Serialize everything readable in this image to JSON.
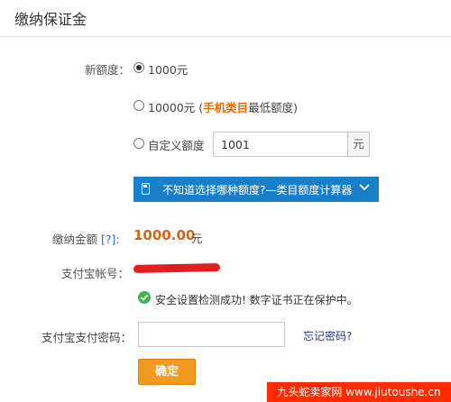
{
  "header": {
    "title": "缴纳保证金"
  },
  "form": {
    "new_quota_label": "新额度：",
    "options": [
      {
        "label": "1000元",
        "checked": true
      },
      {
        "label_prefix": "10000元 (",
        "label_highlight": "手机类目",
        "label_suffix": "最低额度)",
        "checked": false
      },
      {
        "label": "自定义额度",
        "checked": false
      }
    ],
    "custom_value": "1001",
    "custom_unit": "元",
    "calculator_text": "不知道选择哪种额度?—类目额度计算器",
    "pay_amount_label": "缴纳金额",
    "help_link": "[?]",
    "pay_amount_colon": ":",
    "pay_amount_value": "1000.00",
    "pay_amount_unit": "元",
    "alipay_account_label": "支付宝帐号：",
    "security_message": "安全设置检测成功! 数字证书正在保护中。",
    "password_label": "支付宝支付密码：",
    "forgot_password": "忘记密码?",
    "confirm_button": "确定"
  },
  "watermark": "九头蛇卖家网 www.jiutoushe.cn",
  "colors": {
    "accent_blue": "#1a7fc9",
    "highlight_orange": "#e56a00",
    "button_orange": "#f39a1e",
    "success_green": "#3fb34f",
    "redaction_red": "#e02020"
  }
}
